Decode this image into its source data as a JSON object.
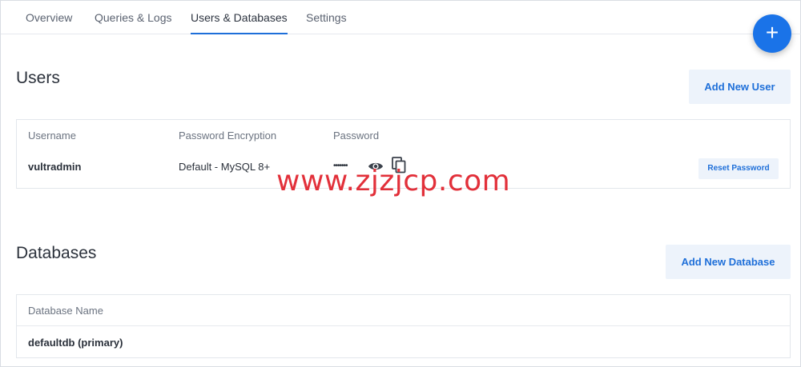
{
  "tabs": [
    {
      "label": "Overview",
      "active": false
    },
    {
      "label": "Queries & Logs",
      "active": false
    },
    {
      "label": "Users & Databases",
      "active": true
    },
    {
      "label": "Settings",
      "active": false
    }
  ],
  "fab": {
    "label": "+",
    "icon": "plus-icon"
  },
  "users": {
    "title": "Users",
    "add_button": "Add New User",
    "columns": [
      "Username",
      "Password Encryption",
      "Password"
    ],
    "rows": [
      {
        "username": "vultradmin",
        "encryption": "Default - MySQL 8+",
        "password_masked": "•••••••",
        "reset_label": "Reset Password"
      }
    ]
  },
  "databases": {
    "title": "Databases",
    "add_button": "Add New Database",
    "columns": [
      "Database Name"
    ],
    "rows": [
      {
        "name": "defaultdb (primary)"
      }
    ]
  },
  "watermark": "www.zjzjcp.com",
  "colors": {
    "accent": "#1e6fd9",
    "fab": "#1a73e8",
    "button_bg": "#edf3fb",
    "watermark": "#e2303a"
  }
}
